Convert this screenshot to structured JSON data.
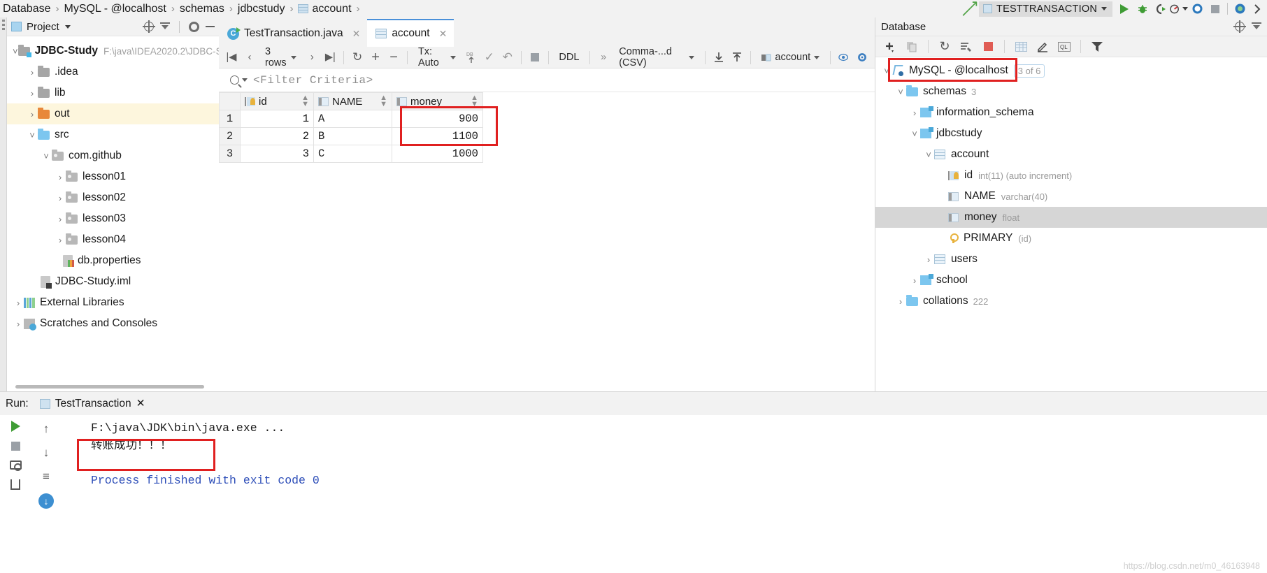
{
  "breadcrumb": {
    "items": [
      "Database",
      "MySQL - @localhost",
      "schemas",
      "jdbcstudy",
      "account"
    ],
    "separator": "›"
  },
  "run_toolbar": {
    "config_name": "TESTTRANSACTION",
    "buttons": [
      "run",
      "debug",
      "run-with-coverage",
      "profile",
      "stop",
      "more"
    ]
  },
  "project_panel": {
    "title": "Project",
    "tools": [
      "locate",
      "collapse-all",
      "settings",
      "hide"
    ],
    "tree": [
      {
        "label": "JDBC-Study",
        "path": "F:\\java\\IDEA2020.2\\JDBC-S",
        "depth": 0,
        "arrow": "expanded",
        "icon": "module-folder",
        "bold": true
      },
      {
        "label": ".idea",
        "depth": 1,
        "arrow": "collapsed",
        "icon": "folder-gray"
      },
      {
        "label": "lib",
        "depth": 1,
        "arrow": "collapsed",
        "icon": "folder-gray"
      },
      {
        "label": "out",
        "depth": 1,
        "arrow": "collapsed",
        "icon": "folder-orange",
        "highlight": true
      },
      {
        "label": "src",
        "depth": 1,
        "arrow": "expanded",
        "icon": "folder-blue"
      },
      {
        "label": "com.github",
        "depth": 2,
        "arrow": "expanded",
        "icon": "package"
      },
      {
        "label": "lesson01",
        "depth": 3,
        "arrow": "collapsed",
        "icon": "package"
      },
      {
        "label": "lesson02",
        "depth": 3,
        "arrow": "collapsed",
        "icon": "package"
      },
      {
        "label": "lesson03",
        "depth": 3,
        "arrow": "collapsed",
        "icon": "package"
      },
      {
        "label": "lesson04",
        "depth": 3,
        "arrow": "collapsed",
        "icon": "package"
      },
      {
        "label": "db.properties",
        "depth": 3,
        "arrow": "none",
        "icon": "properties-file"
      },
      {
        "label": "JDBC-Study.iml",
        "depth": 2,
        "arrow": "none",
        "icon": "iml-file"
      },
      {
        "label": "External Libraries",
        "depth": 0,
        "arrow": "collapsed",
        "icon": "libraries"
      },
      {
        "label": "Scratches and Consoles",
        "depth": 0,
        "arrow": "collapsed",
        "icon": "scratches"
      }
    ]
  },
  "editor": {
    "tabs": [
      {
        "label": "TestTransaction.java",
        "icon": "java-class-icon",
        "active": false,
        "closable": true
      },
      {
        "label": "account",
        "icon": "table-icon",
        "active": true,
        "closable": true
      }
    ]
  },
  "grid_toolbar": {
    "row_count": "3 rows",
    "tx_mode": "Tx: Auto",
    "ddl": "DDL",
    "overflow": "»",
    "format": "Comma-...d (CSV)",
    "table_selector": "account",
    "buttons": [
      "first-page",
      "prev-page",
      "next-page",
      "last-page",
      "reload",
      "add-row",
      "remove-row",
      "submit-db",
      "commit",
      "rollback",
      "cancel-query",
      "export",
      "import",
      "preview",
      "settings"
    ]
  },
  "filter": {
    "placeholder": "<Filter Criteria>"
  },
  "data_grid": {
    "columns": [
      {
        "name": "id",
        "icon": "primary-key-column-icon",
        "sortable": true
      },
      {
        "name": "NAME",
        "icon": "column-icon",
        "sortable": true
      },
      {
        "name": "money",
        "icon": "column-icon",
        "sortable": true
      }
    ],
    "rows": [
      {
        "n": "1",
        "id": "1",
        "NAME": "A",
        "money": "900"
      },
      {
        "n": "2",
        "id": "2",
        "NAME": "B",
        "money": "1100"
      },
      {
        "n": "3",
        "id": "3",
        "NAME": "C",
        "money": "1000"
      }
    ],
    "highlight_color": "#e02020",
    "highlighted_cells": [
      "row1.money",
      "row2.money"
    ]
  },
  "database_panel": {
    "title": "Database",
    "header_tools": [
      "locate",
      "collapse-all"
    ],
    "toolbar_buttons": [
      "add",
      "copy",
      "refresh",
      "sync",
      "stop",
      "table",
      "edit",
      "console",
      "filter"
    ],
    "tree": [
      {
        "label": "MySQL - @localhost",
        "depth": 0,
        "arrow": "expanded",
        "icon": "db-connection-icon",
        "badge": "3 of 6",
        "outlined": true
      },
      {
        "label": "schemas",
        "depth": 1,
        "arrow": "expanded",
        "icon": "folder-blue",
        "count": "3"
      },
      {
        "label": "information_schema",
        "depth": 2,
        "arrow": "collapsed",
        "icon": "schema-icon"
      },
      {
        "label": "jdbcstudy",
        "depth": 2,
        "arrow": "expanded",
        "icon": "schema-icon"
      },
      {
        "label": "account",
        "depth": 3,
        "arrow": "expanded",
        "icon": "table-icon"
      },
      {
        "label": "id",
        "type": "int(11) (auto increment)",
        "depth": 4,
        "arrow": "none",
        "icon": "primary-key-column-icon"
      },
      {
        "label": "NAME",
        "type": "varchar(40)",
        "depth": 4,
        "arrow": "none",
        "icon": "column-icon"
      },
      {
        "label": "money",
        "type": "float",
        "depth": 4,
        "arrow": "none",
        "icon": "column-icon",
        "selected": true
      },
      {
        "label": "PRIMARY",
        "type": "(id)",
        "depth": 4,
        "arrow": "none",
        "icon": "key-icon"
      },
      {
        "label": "users",
        "depth": 3,
        "arrow": "collapsed",
        "icon": "table-icon"
      },
      {
        "label": "school",
        "depth": 2,
        "arrow": "collapsed",
        "icon": "schema-icon"
      },
      {
        "label": "collations",
        "depth": 1,
        "arrow": "collapsed",
        "icon": "folder-blue",
        "count": "222"
      }
    ]
  },
  "run_panel": {
    "label": "Run:",
    "tab": "TestTransaction",
    "rail_buttons": [
      "rerun",
      "stop",
      "screenshot",
      "trash",
      "up-stack",
      "down-stack",
      "soft-wrap",
      "scroll-to-end"
    ],
    "console_lines": [
      {
        "text": "F:\\java\\JDK\\bin\\java.exe ...",
        "color": "black"
      },
      {
        "text": "转账成功！！！",
        "color": "black"
      },
      {
        "text": "",
        "color": "black"
      },
      {
        "text": "Process finished with exit code 0",
        "color": "blue"
      }
    ],
    "highlight_color": "#e02020",
    "watermark": "https://blog.csdn.net/m0_46163948"
  }
}
